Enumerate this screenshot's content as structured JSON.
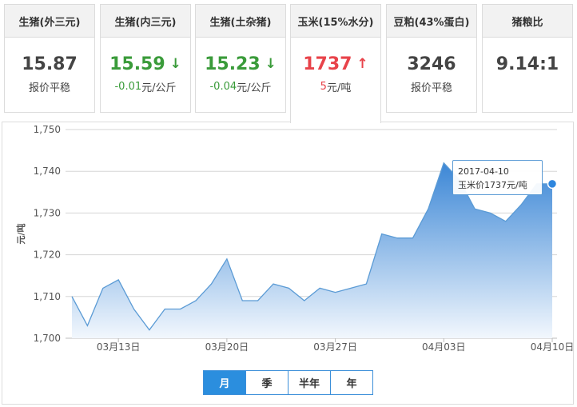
{
  "cards": [
    {
      "title": "生猪(外三元)",
      "value": "15.87",
      "arrow": "",
      "sub_value": "",
      "sub_unit": "报价平稳",
      "trend": "flat"
    },
    {
      "title": "生猪(内三元)",
      "value": "15.59",
      "arrow": "↓",
      "sub_value": "-0.01",
      "sub_unit": "元/公斤",
      "trend": "down"
    },
    {
      "title": "生猪(土杂猪)",
      "value": "15.23",
      "arrow": "↓",
      "sub_value": "-0.04",
      "sub_unit": "元/公斤",
      "trend": "down"
    },
    {
      "title": "玉米(15%水分)",
      "value": "1737",
      "arrow": "↑",
      "sub_value": "5",
      "sub_unit": "元/吨",
      "trend": "up"
    },
    {
      "title": "豆粕(43%蛋白)",
      "value": "3246",
      "arrow": "",
      "sub_value": "",
      "sub_unit": "报价平稳",
      "trend": "flat"
    },
    {
      "title": "猪粮比",
      "value": "9.14:1",
      "arrow": "",
      "sub_value": "",
      "sub_unit": "",
      "trend": "flat"
    }
  ],
  "active_card_index": 3,
  "colors": {
    "up": "#e8434a",
    "down": "#3a9b3a",
    "line": "#5b9bd5",
    "area_top": "#3c87d6",
    "area_bottom": "#f2f7fd",
    "marker": "#2e86de"
  },
  "chart_data": {
    "type": "area",
    "title": "",
    "xlabel": "",
    "ylabel": "元/吨",
    "ylim": [
      1700,
      1750
    ],
    "yticks": [
      1700,
      1710,
      1720,
      1730,
      1740,
      1750
    ],
    "ytick_labels": [
      "1,700",
      "1,710",
      "1,720",
      "1,730",
      "1,740",
      "1,750"
    ],
    "grid": true,
    "x": [
      "03-10",
      "03-11",
      "03-12",
      "03-13",
      "03-14",
      "03-15",
      "03-16",
      "03-17",
      "03-18",
      "03-19",
      "03-20",
      "03-21",
      "03-22",
      "03-23",
      "03-24",
      "03-25",
      "03-26",
      "03-27",
      "03-28",
      "03-29",
      "03-30",
      "03-31",
      "04-01",
      "04-02",
      "04-03",
      "04-04",
      "04-05",
      "04-06",
      "04-07",
      "04-08",
      "04-09",
      "04-10"
    ],
    "x_tick_labels": [
      {
        "x": "03-13",
        "label": "03月13日"
      },
      {
        "x": "03-20",
        "label": "03月20日"
      },
      {
        "x": "03-27",
        "label": "03月27日"
      },
      {
        "x": "04-03",
        "label": "04月03日"
      },
      {
        "x": "04-10",
        "label": "04月10日"
      }
    ],
    "series": [
      {
        "name": "玉米价",
        "values": [
          1710,
          1703,
          1712,
          1714,
          1707,
          1702,
          1707,
          1707,
          1709,
          1713,
          1719,
          1709,
          1709,
          1713,
          1712,
          1709,
          1712,
          1711,
          1712,
          1713,
          1725,
          1724,
          1724,
          1731,
          1742,
          1738,
          1731,
          1730,
          1728,
          1732,
          1737,
          1737
        ]
      }
    ],
    "tooltip": {
      "date": "2017-04-10",
      "label": "玉米价1737元/吨"
    }
  },
  "range_tabs": [
    {
      "label": "月",
      "selected": true
    },
    {
      "label": "季",
      "selected": false
    },
    {
      "label": "半年",
      "selected": false
    },
    {
      "label": "年",
      "selected": false
    }
  ]
}
